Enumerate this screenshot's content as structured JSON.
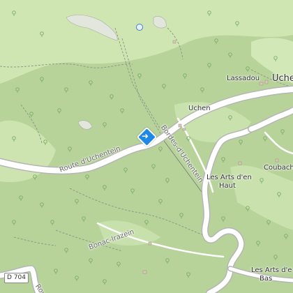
{
  "map": {
    "places": {
      "uchen": "Uchen",
      "lassadou": "Lassadou",
      "uchen_edge": "Uche",
      "coubach": "Coubach",
      "arts_haut_1": "Les Arts d'en",
      "arts_haut_2": "Haut",
      "arts_bas_1": "Les Arts d'e",
      "arts_bas_2": "Bas"
    },
    "roads": {
      "route_uchentein": "Route d'Uchentein",
      "bordes": "Bordes-d'Uchentein",
      "bonac": "Bonac-Irazein",
      "d704": "D 704",
      "partial": "Rou"
    },
    "icons": [
      "directions-icon",
      "poi-icon",
      "tree-icon"
    ],
    "colors": {
      "forest": "#b8d49a",
      "meadow": "#cfe6b5",
      "road": "#ffffff",
      "accent": "#1e88e5"
    }
  }
}
